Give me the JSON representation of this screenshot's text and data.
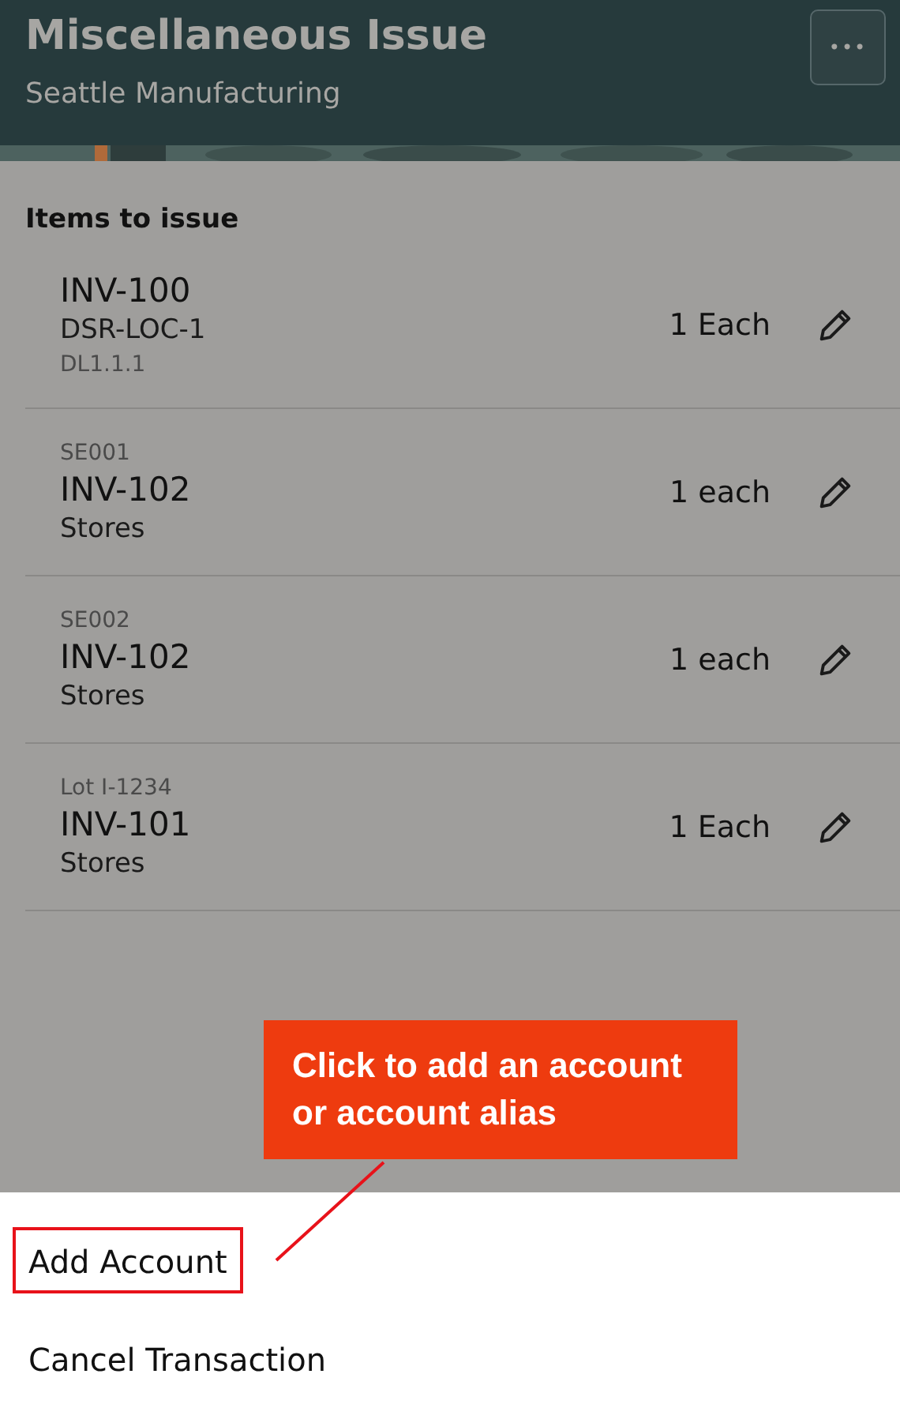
{
  "header": {
    "title": "Miscellaneous Issue",
    "subtitle": "Seattle Manufacturing",
    "more_button": "•••"
  },
  "section_title": "Items to issue",
  "items": [
    {
      "lines": [
        {
          "kind": "main",
          "text": "INV-100"
        },
        {
          "kind": "sub",
          "text": "DSR-LOC-1"
        },
        {
          "kind": "minor",
          "text": "DL1.1.1"
        }
      ],
      "quantity": "1 Each"
    },
    {
      "lines": [
        {
          "kind": "minor",
          "text": "SE001"
        },
        {
          "kind": "main",
          "text": "INV-102"
        },
        {
          "kind": "sub",
          "text": "Stores"
        }
      ],
      "quantity": "1 each"
    },
    {
      "lines": [
        {
          "kind": "minor",
          "text": "SE002"
        },
        {
          "kind": "main",
          "text": "INV-102"
        },
        {
          "kind": "sub",
          "text": "Stores"
        }
      ],
      "quantity": "1 each"
    },
    {
      "lines": [
        {
          "kind": "minor",
          "text": "Lot I-1234"
        },
        {
          "kind": "main",
          "text": "INV-101"
        },
        {
          "kind": "sub",
          "text": "Stores"
        }
      ],
      "quantity": "1 Each"
    }
  ],
  "menu": [
    {
      "label": "Add Account",
      "highlighted": true
    },
    {
      "label": "Cancel Transaction",
      "highlighted": false
    }
  ],
  "callout": {
    "text": "Click to add an account or account alias"
  }
}
